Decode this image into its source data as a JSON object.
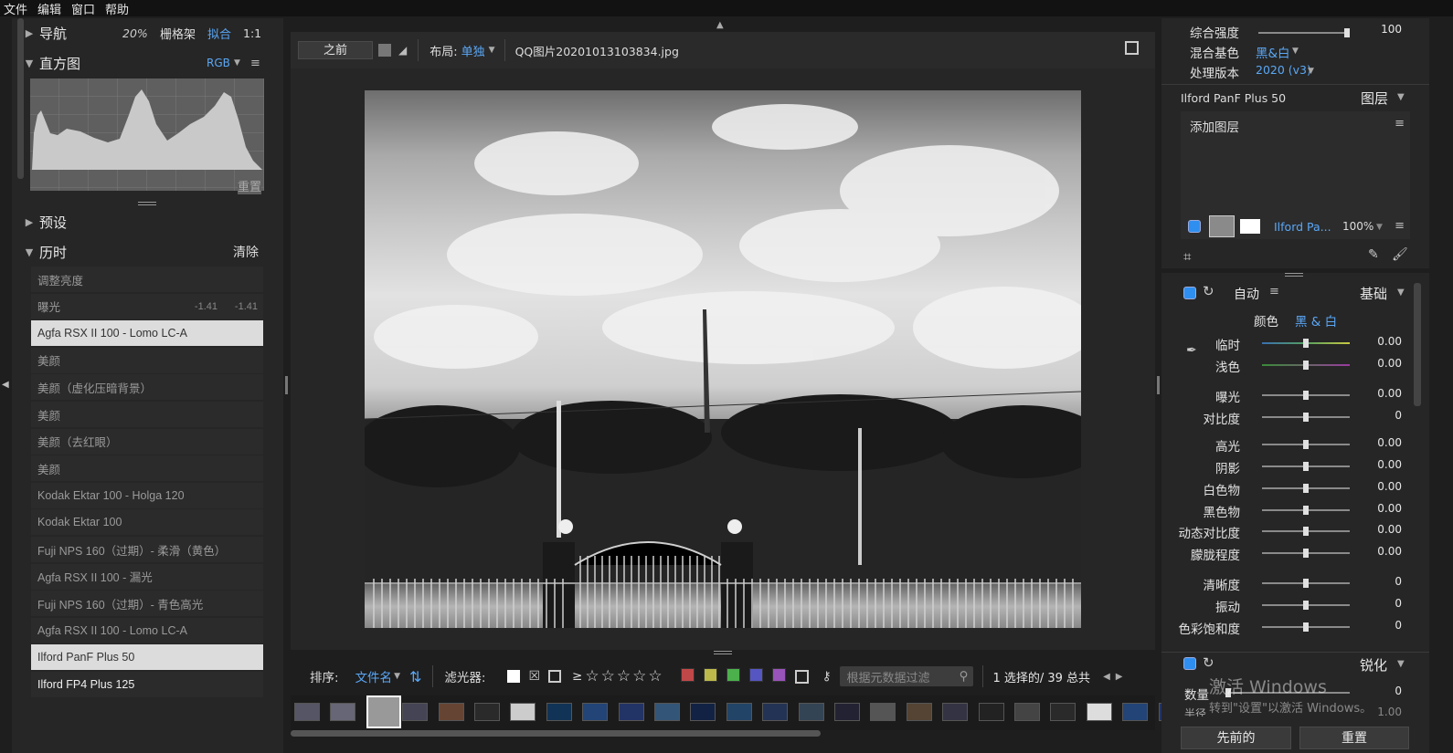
{
  "menu": [
    "文件",
    "编辑",
    "窗口",
    "帮助"
  ],
  "left": {
    "navigator": {
      "title": "导航",
      "zoom_20": "20%",
      "grid": "栅格架",
      "fit": "拟合",
      "one_to_one": "1:1"
    },
    "histogram": {
      "title": "直方图",
      "channel": "RGB",
      "reset": "重置"
    },
    "presets": {
      "title": "预设"
    },
    "history": {
      "title": "历时",
      "clear": "清除",
      "items": [
        {
          "label": "调整亮度",
          "v1": "",
          "v2": ""
        },
        {
          "label": "曝光",
          "v1": "-1.41",
          "v2": "-1.41"
        },
        {
          "label": "Agfa RSX II 100 - Lomo LC-A",
          "v1": "",
          "v2": ""
        },
        {
          "label": "美颜",
          "v1": "",
          "v2": ""
        },
        {
          "label": "美颜（虚化压暗背景）",
          "v1": "",
          "v2": ""
        },
        {
          "label": "美颜",
          "v1": "",
          "v2": ""
        },
        {
          "label": "美颜（去红眼）",
          "v1": "",
          "v2": ""
        },
        {
          "label": "美颜",
          "v1": "",
          "v2": ""
        },
        {
          "label": "Kodak Ektar 100 - Holga 120",
          "v1": "",
          "v2": ""
        },
        {
          "label": "Kodak Ektar 100",
          "v1": "",
          "v2": ""
        },
        {
          "label": "Fuji NPS 160（过期）- 柔滑（黄色）",
          "v1": "",
          "v2": ""
        },
        {
          "label": "Agfa RSX II 100 - 漏光",
          "v1": "",
          "v2": ""
        },
        {
          "label": "Fuji NPS 160（过期）- 青色高光",
          "v1": "",
          "v2": ""
        },
        {
          "label": "Agfa RSX II 100 - Lomo LC-A",
          "v1": "",
          "v2": ""
        },
        {
          "label": "Ilford PanF Plus 50",
          "v1": "",
          "v2": ""
        },
        {
          "label": "Ilford FP4 Plus 125",
          "v1": "",
          "v2": ""
        }
      ]
    }
  },
  "center": {
    "before": "之前",
    "layout_label": "布局:",
    "layout_value": "单独",
    "filename": "QQ图片20201013103834.jpg",
    "sort_label": "排序:",
    "sort_value": "文件名",
    "filter_label": "滤光器:",
    "gte": "≥",
    "colors": [
      "#c04848",
      "#bdb94a",
      "#4cb04c",
      "#5656c2",
      "#9854b8"
    ],
    "meta_placeholder": "根据元数据过滤",
    "count": "1 选择的/ 39 总共"
  },
  "right": {
    "strength_label": "综合强度",
    "strength_value": "100",
    "strength_level": 1.0,
    "blend_label": "混合基色",
    "blend_value": "黑&白",
    "version_label": "处理版本",
    "version_value": "2020 (v3)",
    "preset_name": "Ilford PanF Plus 50",
    "layers": "图层",
    "add_layer": "添加图层",
    "layer_name": "Ilford Pa...",
    "layer_opacity": "100%",
    "auto": "自动",
    "basic": "基础",
    "color_label": "颜色",
    "bw_label": "黑 & 白",
    "sliders": [
      {
        "label": "临时",
        "value": "0.00",
        "level": 0.5
      },
      {
        "label": "浅色",
        "value": "0.00",
        "level": 0.5
      },
      {
        "label": "曝光",
        "value": "0.00",
        "level": 0.5
      },
      {
        "label": "对比度",
        "value": "0",
        "level": 0.5
      },
      {
        "label": "高光",
        "value": "0.00",
        "level": 0.5
      },
      {
        "label": "阴影",
        "value": "0.00",
        "level": 0.5
      },
      {
        "label": "白色物",
        "value": "0.00",
        "level": 0.5
      },
      {
        "label": "黑色物",
        "value": "0.00",
        "level": 0.5
      },
      {
        "label": "动态对比度",
        "value": "0.00",
        "level": 0.5
      },
      {
        "label": "朦胧程度",
        "value": "0.00",
        "level": 0.5
      },
      {
        "label": "清晰度",
        "value": "0",
        "level": 0.5
      },
      {
        "label": "振动",
        "value": "0",
        "level": 0.5
      },
      {
        "label": "色彩饱和度",
        "value": "0",
        "level": 0.5
      }
    ],
    "sharpen": "锐化",
    "amount_label": "数量",
    "amount_value": "0",
    "radius_label": "半径",
    "radius_value": "1.00",
    "prev_button": "先前的",
    "reset_button": "重置",
    "watermark1": "激活 Windows",
    "watermark2": "转到\"设置\"以激活 Windows。"
  }
}
